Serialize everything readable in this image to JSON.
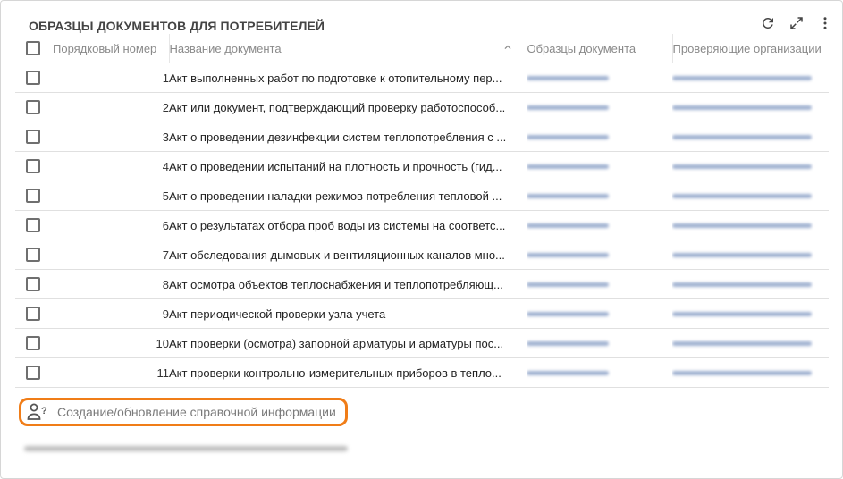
{
  "panel": {
    "title": "ОБРАЗЦЫ ДОКУМЕНТОВ ДЛЯ ПОТРЕБИТЕЛЕЙ",
    "toolbar": {
      "refresh_icon": "refresh-icon",
      "expand_icon": "expand-icon",
      "more_icon": "more-vertical-icon"
    }
  },
  "table": {
    "headers": {
      "number": "Порядковый номер",
      "name": "Название документа",
      "samples": "Образцы документа",
      "orgs": "Проверяющие организации"
    },
    "sort_icon": "chevron-up-icon",
    "rows": [
      {
        "num": "1",
        "name": "Акт выполненных работ по подготовке к отопительному пер..."
      },
      {
        "num": "2",
        "name": "Акт или документ, подтверждающий проверку работоспособ..."
      },
      {
        "num": "3",
        "name": "Акт о проведении дезинфекции систем теплопотребления с ..."
      },
      {
        "num": "4",
        "name": "Акт о проведении испытаний на плотность и прочность (гид..."
      },
      {
        "num": "5",
        "name": "Акт о проведении наладки режимов потребления тепловой ..."
      },
      {
        "num": "6",
        "name": "Акт о результатах отбора проб воды из системы на соответс..."
      },
      {
        "num": "7",
        "name": "Акт обследования дымовых и вентиляционных каналов мно..."
      },
      {
        "num": "8",
        "name": "Акт осмотра объектов теплоснабжения и теплопотребляющ..."
      },
      {
        "num": "9",
        "name": "Акт периодической проверки узла учета"
      },
      {
        "num": "10",
        "name": "Акт проверки (осмотра) запорной арматуры и арматуры пос..."
      },
      {
        "num": "11",
        "name": "Акт проверки контрольно-измерительных приборов в тепло..."
      }
    ]
  },
  "reference_link": {
    "icon": "person-question-icon",
    "label": "Создание/обновление справочной информации"
  },
  "colors": {
    "highlight_border": "#f07d18",
    "blurred_link": "#8ea3c8"
  }
}
